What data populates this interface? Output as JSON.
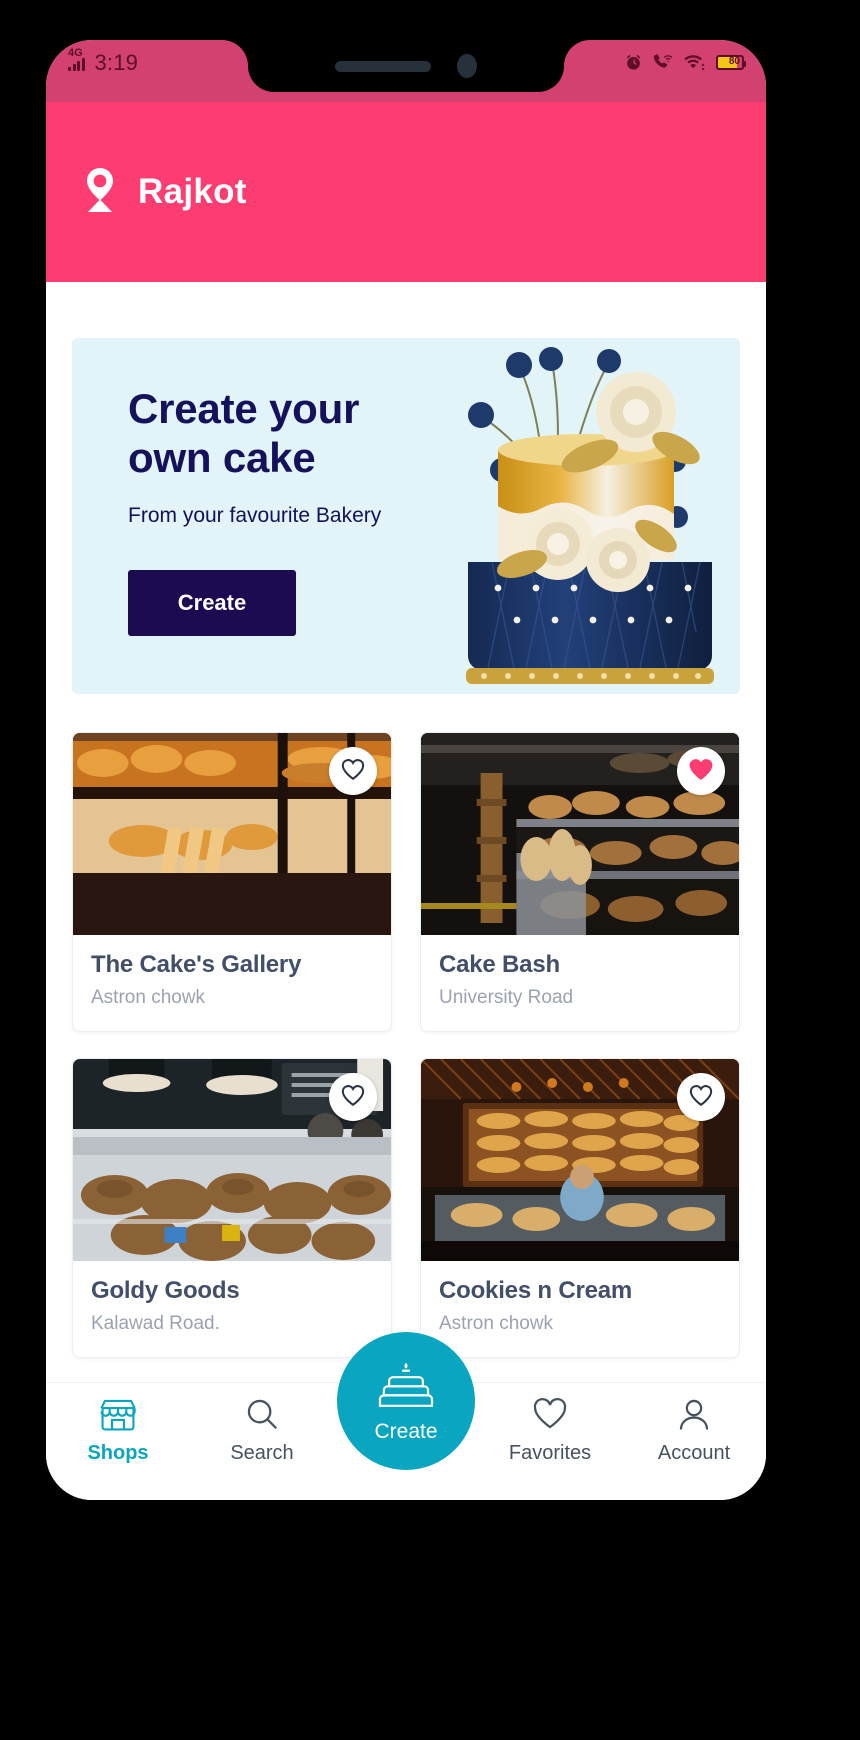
{
  "status_bar": {
    "network_type": "4G",
    "time": "3:19",
    "battery_percent": "80",
    "icons": [
      "signal-bars-icon",
      "alarm-clock-icon",
      "wifi-calling-icon",
      "wifi-icon",
      "battery-icon"
    ]
  },
  "header": {
    "location_icon": "location-pin-icon",
    "title": "Rajkot",
    "background_color": "#fd3d71"
  },
  "banner": {
    "title_line1": "Create your",
    "title_line2": "own cake",
    "subtitle": "From your favourite Bakery",
    "button_label": "Create",
    "background_color": "#e2f4f8",
    "button_color": "#1d0b52",
    "text_color": "#15115a",
    "image": "tiered-cake-photo"
  },
  "shops": [
    {
      "name": "The Cake's Gallery",
      "location": "Astron chowk",
      "favorited": false,
      "image": "bakery-display-case-photo"
    },
    {
      "name": "Cake Bash",
      "location": "University Road",
      "favorited": true,
      "image": "bakery-interior-shelves-photo"
    },
    {
      "name": "Goldy Goods",
      "location": "Kalawad Road.",
      "favorited": false,
      "image": "bakery-counter-staff-photo"
    },
    {
      "name": "Cookies n Cream",
      "location": "Astron chowk",
      "favorited": false,
      "image": "warm-lit-bakery-photo"
    }
  ],
  "tabbar": {
    "active_color": "#0aa5c0",
    "inactive_color": "#46535f",
    "items": [
      {
        "label": "Shops",
        "icon": "storefront-icon",
        "active": true
      },
      {
        "label": "Search",
        "icon": "search-icon",
        "active": false
      },
      {
        "label": "Create",
        "icon": "cake-icon",
        "active": false
      },
      {
        "label": "Favorites",
        "icon": "heart-icon",
        "active": false
      },
      {
        "label": "Account",
        "icon": "person-icon",
        "active": false
      }
    ]
  }
}
